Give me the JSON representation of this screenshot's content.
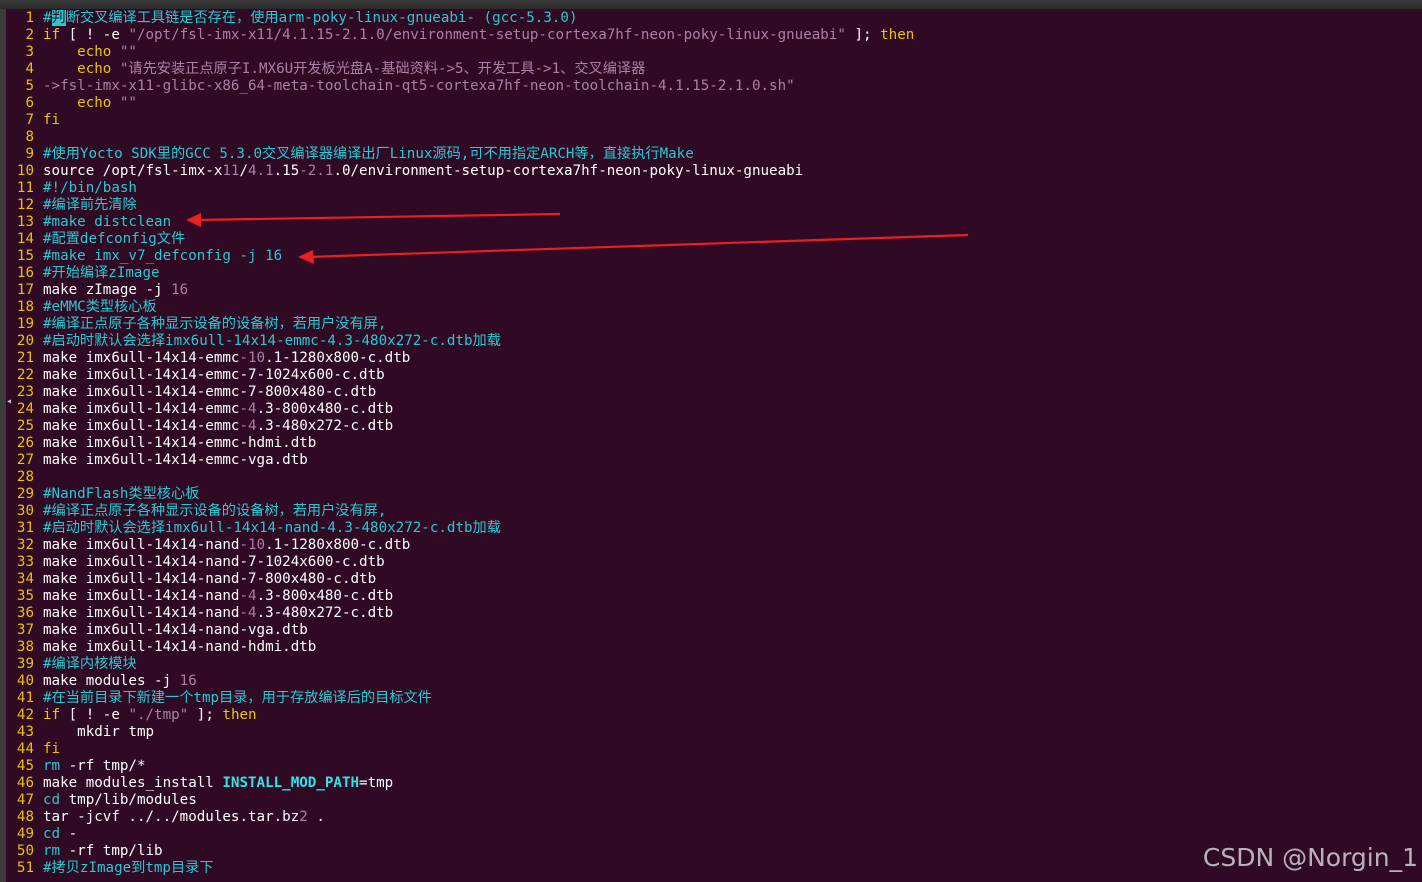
{
  "colors": {
    "background": "#300a24",
    "line_number": "#e8c20a",
    "comment": "#29c9d0",
    "string": "#ad7fa8",
    "keyword": "#e9c214",
    "arrow": "#e82020"
  },
  "lines": [
    {
      "n": "1",
      "parts": [
        {
          "t": "#",
          "c": "c"
        },
        {
          "t": "判",
          "c": "cursor"
        },
        {
          "t": "断交叉编译工具链是否存在，使用arm-poky-linux-gnueabi- (gcc-5.3.0)",
          "c": "c"
        }
      ]
    },
    {
      "n": "2",
      "parts": [
        {
          "t": "if",
          "c": "kw"
        },
        {
          "t": " [ ! -e ",
          "c": "t"
        },
        {
          "t": "\"/opt/fsl-imx-x11/4.1.15-2.1.0/environment-setup-cortexa7hf-neon-poky-linux-gnueabi\"",
          "c": "s"
        },
        {
          "t": " ]; ",
          "c": "t"
        },
        {
          "t": "then",
          "c": "kw"
        }
      ]
    },
    {
      "n": "3",
      "parts": [
        {
          "t": "    ",
          "c": "t"
        },
        {
          "t": "echo",
          "c": "kw"
        },
        {
          "t": " ",
          "c": "t"
        },
        {
          "t": "\"\"",
          "c": "s"
        }
      ]
    },
    {
      "n": "4",
      "parts": [
        {
          "t": "    ",
          "c": "t"
        },
        {
          "t": "echo",
          "c": "kw"
        },
        {
          "t": " ",
          "c": "t"
        },
        {
          "t": "\"请先安装正点原子I.MX6U开发板光盘A-基础资料->5、开发工具->1、交叉编译器",
          "c": "s"
        }
      ]
    },
    {
      "n": "5",
      "parts": [
        {
          "t": "->fsl-imx-x11-glibc-x86_64-meta-toolchain-qt5-cortexa7hf-neon-toolchain-4.1.15-2.1.0.sh\"",
          "c": "s"
        }
      ]
    },
    {
      "n": "6",
      "parts": [
        {
          "t": "    ",
          "c": "t"
        },
        {
          "t": "echo",
          "c": "kw"
        },
        {
          "t": " ",
          "c": "t"
        },
        {
          "t": "\"\"",
          "c": "s"
        }
      ]
    },
    {
      "n": "7",
      "parts": [
        {
          "t": "fi",
          "c": "kw"
        }
      ]
    },
    {
      "n": "8",
      "parts": []
    },
    {
      "n": "9",
      "parts": [
        {
          "t": "#使用Yocto SDK里的GCC 5.3.0交叉编译器编译出厂Linux源码,可不用指定ARCH等，直接执行Make",
          "c": "c"
        }
      ]
    },
    {
      "n": "10",
      "parts": [
        {
          "t": "source /opt/fsl-imx-x",
          "c": "t"
        },
        {
          "t": "11",
          "c": "n"
        },
        {
          "t": "/",
          "c": "t"
        },
        {
          "t": "4.1",
          "c": "n"
        },
        {
          "t": ".15",
          "c": "t"
        },
        {
          "t": "-2.1",
          "c": "n"
        },
        {
          "t": ".0/environment-setup-cortexa7hf-neon-poky-linux-gnueabi",
          "c": "t"
        }
      ]
    },
    {
      "n": "11",
      "parts": [
        {
          "t": "#!/bin/bash",
          "c": "c"
        }
      ]
    },
    {
      "n": "12",
      "parts": [
        {
          "t": "#编译前先清除",
          "c": "c"
        }
      ]
    },
    {
      "n": "13",
      "parts": [
        {
          "t": "#make distclean",
          "c": "c"
        }
      ]
    },
    {
      "n": "14",
      "parts": [
        {
          "t": "#配置defconfig文件",
          "c": "c"
        }
      ]
    },
    {
      "n": "15",
      "parts": [
        {
          "t": "#make imx_v7_defconfig -j 16",
          "c": "c"
        }
      ]
    },
    {
      "n": "16",
      "parts": [
        {
          "t": "#开始编译zImage",
          "c": "c"
        }
      ]
    },
    {
      "n": "17",
      "parts": [
        {
          "t": "make zImage -j ",
          "c": "t"
        },
        {
          "t": "16",
          "c": "n"
        }
      ]
    },
    {
      "n": "18",
      "parts": [
        {
          "t": "#eMMC类型核心板",
          "c": "c"
        }
      ]
    },
    {
      "n": "19",
      "parts": [
        {
          "t": "#编译正点原子各种显示设备的设备树，若用户没有屏,",
          "c": "c"
        }
      ]
    },
    {
      "n": "20",
      "parts": [
        {
          "t": "#启动时默认会选择imx6ull-14x14-emmc-4.3-480x272-c.dtb加载",
          "c": "c"
        }
      ]
    },
    {
      "n": "21",
      "parts": [
        {
          "t": "make imx6ull-14x14-emmc",
          "c": "t"
        },
        {
          "t": "-10",
          "c": "n"
        },
        {
          "t": ".1-1280x800-c.dtb",
          "c": "t"
        }
      ]
    },
    {
      "n": "22",
      "parts": [
        {
          "t": "make imx6ull-14x14-emmc-7-1024x600-c.dtb",
          "c": "t"
        }
      ]
    },
    {
      "n": "23",
      "parts": [
        {
          "t": "make imx6ull-14x14-emmc-7-800x480-c.dtb",
          "c": "t"
        }
      ]
    },
    {
      "n": "24",
      "parts": [
        {
          "t": "make imx6ull-14x14-emmc",
          "c": "t"
        },
        {
          "t": "-4",
          "c": "n"
        },
        {
          "t": ".3-800x480-c.dtb",
          "c": "t"
        }
      ]
    },
    {
      "n": "25",
      "parts": [
        {
          "t": "make imx6ull-14x14-emmc",
          "c": "t"
        },
        {
          "t": "-4",
          "c": "n"
        },
        {
          "t": ".3-480x272-c.dtb",
          "c": "t"
        }
      ]
    },
    {
      "n": "26",
      "parts": [
        {
          "t": "make imx6ull-14x14-emmc-hdmi.dtb",
          "c": "t"
        }
      ]
    },
    {
      "n": "27",
      "parts": [
        {
          "t": "make imx6ull-14x14-emmc-vga.dtb",
          "c": "t"
        }
      ]
    },
    {
      "n": "28",
      "parts": []
    },
    {
      "n": "29",
      "parts": [
        {
          "t": "#NandFlash类型核心板",
          "c": "c"
        }
      ]
    },
    {
      "n": "30",
      "parts": [
        {
          "t": "#编译正点原子各种显示设备的设备树，若用户没有屏,",
          "c": "c"
        }
      ]
    },
    {
      "n": "31",
      "parts": [
        {
          "t": "#启动时默认会选择imx6ull-14x14-nand-4.3-480x272-c.dtb加载",
          "c": "c"
        }
      ]
    },
    {
      "n": "32",
      "parts": [
        {
          "t": "make imx6ull-14x14-nand",
          "c": "t"
        },
        {
          "t": "-10",
          "c": "n"
        },
        {
          "t": ".1-1280x800-c.dtb",
          "c": "t"
        }
      ]
    },
    {
      "n": "33",
      "parts": [
        {
          "t": "make imx6ull-14x14-nand-7-1024x600-c.dtb",
          "c": "t"
        }
      ]
    },
    {
      "n": "34",
      "parts": [
        {
          "t": "make imx6ull-14x14-nand-7-800x480-c.dtb",
          "c": "t"
        }
      ]
    },
    {
      "n": "35",
      "parts": [
        {
          "t": "make imx6ull-14x14-nand",
          "c": "t"
        },
        {
          "t": "-4",
          "c": "n"
        },
        {
          "t": ".3-800x480-c.dtb",
          "c": "t"
        }
      ]
    },
    {
      "n": "36",
      "parts": [
        {
          "t": "make imx6ull-14x14-nand",
          "c": "t"
        },
        {
          "t": "-4",
          "c": "n"
        },
        {
          "t": ".3-480x272-c.dtb",
          "c": "t"
        }
      ]
    },
    {
      "n": "37",
      "parts": [
        {
          "t": "make imx6ull-14x14-nand-vga.dtb",
          "c": "t"
        }
      ]
    },
    {
      "n": "38",
      "parts": [
        {
          "t": "make imx6ull-14x14-nand-hdmi.dtb",
          "c": "t"
        }
      ]
    },
    {
      "n": "39",
      "parts": [
        {
          "t": "#编译内核模块",
          "c": "c"
        }
      ]
    },
    {
      "n": "40",
      "parts": [
        {
          "t": "make modules -j ",
          "c": "t"
        },
        {
          "t": "16",
          "c": "n"
        }
      ]
    },
    {
      "n": "41",
      "parts": [
        {
          "t": "#在当前目录下新建一个tmp目录，用于存放编译后的目标文件",
          "c": "c"
        }
      ]
    },
    {
      "n": "42",
      "parts": [
        {
          "t": "if",
          "c": "kw"
        },
        {
          "t": " [ ! -e ",
          "c": "t"
        },
        {
          "t": "\"./tmp\"",
          "c": "s"
        },
        {
          "t": " ]; ",
          "c": "t"
        },
        {
          "t": "then",
          "c": "kw"
        }
      ]
    },
    {
      "n": "43",
      "parts": [
        {
          "t": "    mkdir tmp",
          "c": "t"
        }
      ]
    },
    {
      "n": "44",
      "parts": [
        {
          "t": "fi",
          "c": "kw"
        }
      ]
    },
    {
      "n": "45",
      "parts": [
        {
          "t": "rm",
          "c": "cy"
        },
        {
          "t": " -rf tmp/*",
          "c": "t"
        }
      ]
    },
    {
      "n": "46",
      "parts": [
        {
          "t": "make modules_install ",
          "c": "t"
        },
        {
          "t": "INSTALL_MOD_PATH",
          "c": "var"
        },
        {
          "t": "=tmp",
          "c": "t"
        }
      ]
    },
    {
      "n": "47",
      "parts": [
        {
          "t": "cd",
          "c": "cy"
        },
        {
          "t": " tmp/lib/modules",
          "c": "t"
        }
      ]
    },
    {
      "n": "48",
      "parts": [
        {
          "t": "tar -jcvf ../../modules.tar.bz",
          "c": "t"
        },
        {
          "t": "2",
          "c": "n"
        },
        {
          "t": " .",
          "c": "t"
        }
      ]
    },
    {
      "n": "49",
      "parts": [
        {
          "t": "cd",
          "c": "cy"
        },
        {
          "t": " -",
          "c": "t"
        }
      ]
    },
    {
      "n": "50",
      "parts": [
        {
          "t": "rm",
          "c": "cy"
        },
        {
          "t": " -rf tmp/lib",
          "c": "t"
        }
      ]
    },
    {
      "n": "51",
      "parts": [
        {
          "t": "#拷贝zImage到tmp目录下",
          "c": "c"
        }
      ]
    }
  ],
  "watermark": "CSDN @Norgin_1"
}
